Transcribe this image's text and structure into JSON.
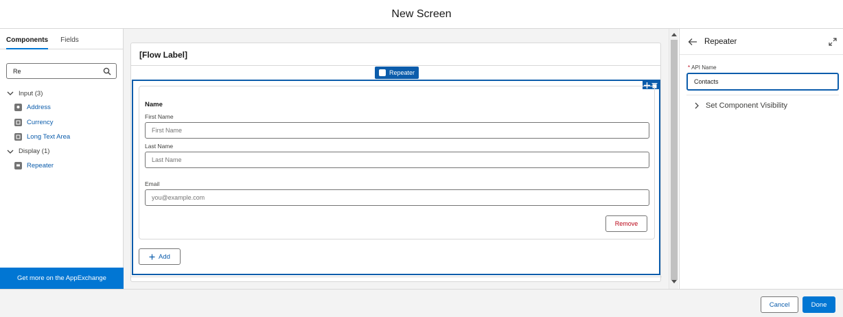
{
  "header": {
    "title": "New Screen"
  },
  "left_panel": {
    "tabs": [
      {
        "label": "Components",
        "active": true
      },
      {
        "label": "Fields",
        "active": false
      }
    ],
    "search": {
      "value": "Re",
      "icon": "search-icon"
    },
    "groups": [
      {
        "label": "Input (3)",
        "items": [
          "Address",
          "Currency",
          "Long Text Area"
        ]
      },
      {
        "label": "Display (1)",
        "items": [
          "Repeater"
        ]
      }
    ],
    "appexchange_label": "Get more on the AppExchange"
  },
  "canvas": {
    "flow_label": "[Flow Label]",
    "repeater_tag": "Repeater",
    "section_name": "Name",
    "first_name_label": "First Name",
    "first_name_placeholder": "First Name",
    "last_name_label": "Last Name",
    "last_name_placeholder": "Last Name",
    "email_label": "Email",
    "email_placeholder": "you@example.com",
    "remove_label": "Remove",
    "add_label": "Add"
  },
  "right_panel": {
    "title": "Repeater",
    "api_name_label": "API Name",
    "api_name_value": "Contacts",
    "visibility_label": "Set Component Visibility"
  },
  "footer": {
    "cancel_label": "Cancel",
    "done_label": "Done"
  },
  "colors": {
    "brand": "#0176d3",
    "selection": "#0b5cab",
    "danger": "#ba0517"
  }
}
